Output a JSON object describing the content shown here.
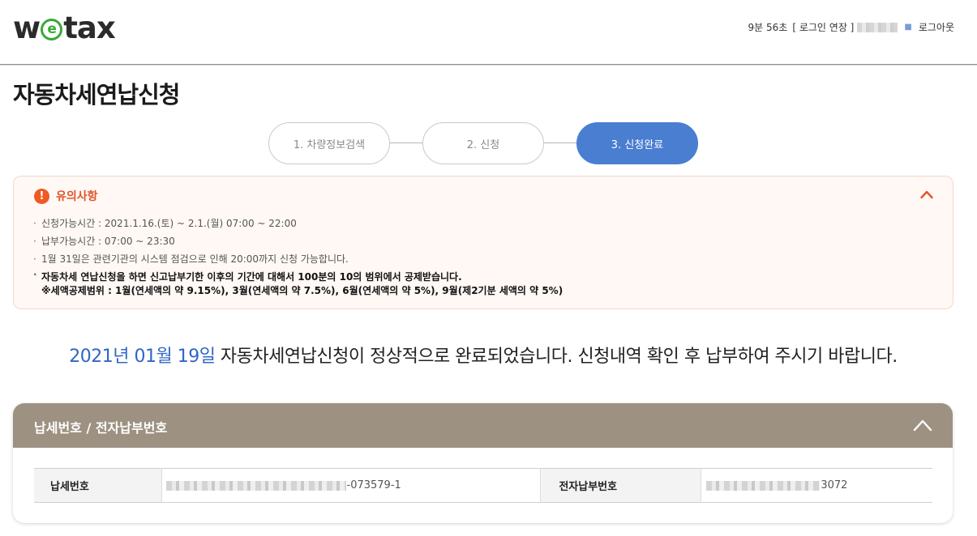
{
  "header": {
    "logo_pre": "w",
    "logo_e": "e",
    "logo_post": "tax",
    "session_timer": "9분 56초",
    "extend_login": "[ 로그인 연장 ]",
    "logout": "로그아웃"
  },
  "page": {
    "title": "자동차세연납신청"
  },
  "steps": [
    {
      "label": "1. 차량정보검색",
      "active": false
    },
    {
      "label": "2. 신청",
      "active": false
    },
    {
      "label": "3. 신청완료",
      "active": true
    }
  ],
  "notice": {
    "title": "유의사항",
    "items": [
      "신청가능시간 : 2021.1.16.(토) ~ 2.1.(월) 07:00 ~ 22:00",
      "납부가능시간 : 07:00 ~ 23:30",
      "1월 31일은 관련기관의 시스템 점검으로 인해 20:00까지 신청 가능합니다."
    ],
    "bold_item": "자동차세 연납신청을 하면 신고납부기한 이후의 기간에 대해서 100분의 10의 범위에서 공제받습니다.",
    "bold_sub": "※세액공제범위 : 1월(연세액의 약 9.15%), 3월(연세액의 약 7.5%), 6월(연세액의 약 5%), 9월(제2기분 세액의 약 5%)"
  },
  "completion": {
    "date": "2021년 01월 19일",
    "message": " 자동차세연납신청이 정상적으로 완료되었습니다. 신청내역 확인 후 납부하여 주시기 바랍니다."
  },
  "payment": {
    "title": "납세번호 / 전자납부번호",
    "tax_no_label": "납세번호",
    "tax_no_suffix": "-073579-1",
    "e_pay_label": "전자납부번호",
    "e_pay_suffix": "3072"
  },
  "colors": {
    "accent_blue": "#4a7ed0",
    "notice_orange": "#f05a24",
    "panel_brown": "#9d9282",
    "date_blue": "#2f66c5"
  }
}
